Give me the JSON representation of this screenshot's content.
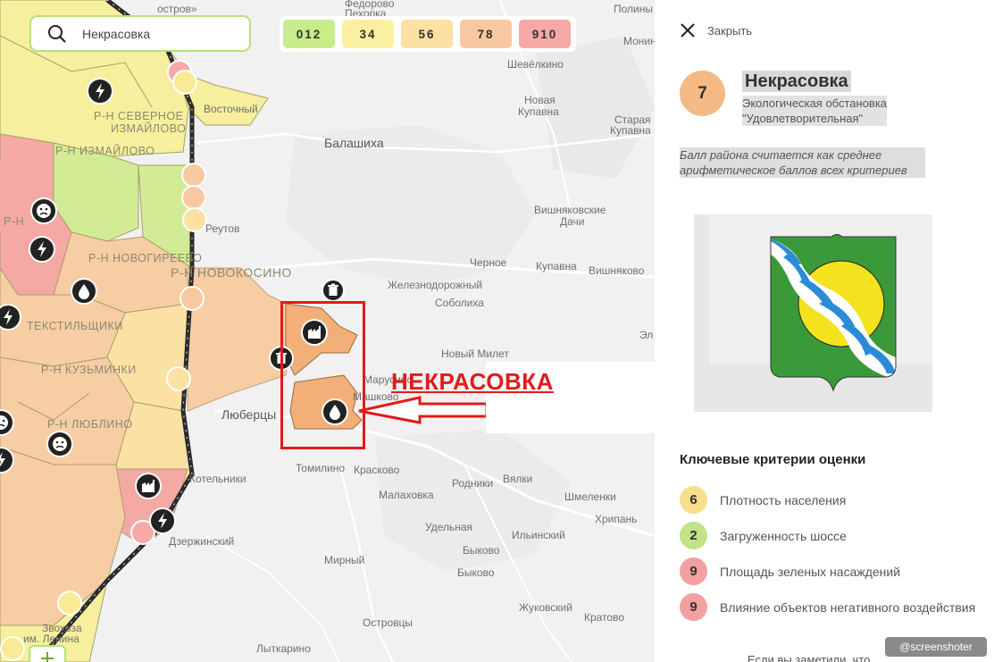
{
  "search": {
    "value": "Некрасовка"
  },
  "legend": {
    "chips": [
      {
        "label": "012",
        "color": "#c9ec8a"
      },
      {
        "label": "34",
        "color": "#fbf0a0"
      },
      {
        "label": "56",
        "color": "#fce1a2"
      },
      {
        "label": "78",
        "color": "#f8c9a0"
      },
      {
        "label": "910",
        "color": "#f6a9a8"
      }
    ]
  },
  "map": {
    "places": [
      {
        "name": "остров»",
        "key": "p0"
      },
      {
        "name": "Федорово",
        "key": "p1"
      },
      {
        "name": "Пехорка",
        "key": "p2"
      },
      {
        "name": "Полины",
        "key": "p3"
      },
      {
        "name": "Монино",
        "key": "p4"
      },
      {
        "name": "Шевёлкино",
        "key": "p5"
      },
      {
        "name": "Новая",
        "key": "p6"
      },
      {
        "name": "Купавна",
        "key": "p7"
      },
      {
        "name": "Старая",
        "key": "p8"
      },
      {
        "name": "Купавна",
        "key": "p9"
      },
      {
        "name": "Балашиха",
        "key": "p10"
      },
      {
        "name": "Восточный",
        "key": "p11"
      },
      {
        "name": "Вишняковские",
        "key": "p12"
      },
      {
        "name": "Дачи",
        "key": "p13"
      },
      {
        "name": "Реутов",
        "key": "p14"
      },
      {
        "name": "Черное",
        "key": "p15"
      },
      {
        "name": "Купавна",
        "key": "p16"
      },
      {
        "name": "Вишняково",
        "key": "p17"
      },
      {
        "name": "Железнодорожный",
        "key": "p18"
      },
      {
        "name": "Соболиха",
        "key": "p19"
      },
      {
        "name": "Новый Милет",
        "key": "p20"
      },
      {
        "name": "Марусино",
        "key": "p21"
      },
      {
        "name": "Машково",
        "key": "p22"
      },
      {
        "name": "Люберцы",
        "key": "p23"
      },
      {
        "name": "Томилино",
        "key": "p24"
      },
      {
        "name": "Красково",
        "key": "p25"
      },
      {
        "name": "Родники",
        "key": "p26"
      },
      {
        "name": "Вялки",
        "key": "p27"
      },
      {
        "name": "Котельники",
        "key": "p28"
      },
      {
        "name": "Малаховка",
        "key": "p29"
      },
      {
        "name": "Шмеленки",
        "key": "p30"
      },
      {
        "name": "Хрипань",
        "key": "p31"
      },
      {
        "name": "Удельная",
        "key": "p32"
      },
      {
        "name": "Ильинский",
        "key": "p33"
      },
      {
        "name": "Дзержинский",
        "key": "p34"
      },
      {
        "name": "Быково",
        "key": "p35"
      },
      {
        "name": "Мирный",
        "key": "p36"
      },
      {
        "name": "Быково",
        "key": "p37"
      },
      {
        "name": "Жуковский",
        "key": "p38"
      },
      {
        "name": "Кратово",
        "key": "p39"
      },
      {
        "name": "Островцы",
        "key": "p40"
      },
      {
        "name": "Лыткарино",
        "key": "p41"
      },
      {
        "name": "Эл",
        "key": "p42"
      },
      {
        "name": "Звохоза",
        "key": "p43"
      },
      {
        "name": "им. Ленина",
        "key": "p44"
      }
    ],
    "districts": [
      {
        "name": "Р-Н СЕВЕРНОЕ",
        "key": "d0"
      },
      {
        "name": "ИЗМАЙЛОВО",
        "key": "d1"
      },
      {
        "name": "Р-Н ИЗМАЙЛОВО",
        "key": "d2"
      },
      {
        "name": "Р-Н",
        "key": "d3"
      },
      {
        "name": "Р-Н НОВОГИРЕЕВО",
        "key": "d4"
      },
      {
        "name": "Р-Н НОВОКОСИНО",
        "key": "d5"
      },
      {
        "name": "ТЕКСТИЛЬЩИКИ",
        "key": "d6"
      },
      {
        "name": "Р-Н КУЗЬМИНКИ",
        "key": "d7"
      },
      {
        "name": "Р-Н ЛЮБЛИНО",
        "key": "d8"
      }
    ],
    "annotation": "НЕКРАСОВКА"
  },
  "panel": {
    "close_label": "Закрыть",
    "score": "7",
    "score_color": "#f4b985",
    "district_name": "Некрасовка",
    "status_line1": "Экологическая обстановка",
    "status_line2": "\"Удовлетворительная\"",
    "note_line1": "Балл района считается как среднее",
    "note_line2": "арифметическое баллов всех критериев",
    "criteria_title": "Ключевые критерии оценки",
    "criteria": [
      {
        "score": "6",
        "label": "Плотность населения",
        "color": "#f7dd8c"
      },
      {
        "score": "2",
        "label": "Загруженность шоссе",
        "color": "#c2e388"
      },
      {
        "score": "9",
        "label": "Площадь зеленых насаждений",
        "color": "#f2a0a0"
      },
      {
        "score": "9",
        "label": "Влияние объектов негативного воздействия",
        "color": "#f2a0a0"
      }
    ],
    "bottom_text": "Если вы заметили, что ..."
  },
  "watermark": "@screenshoter"
}
